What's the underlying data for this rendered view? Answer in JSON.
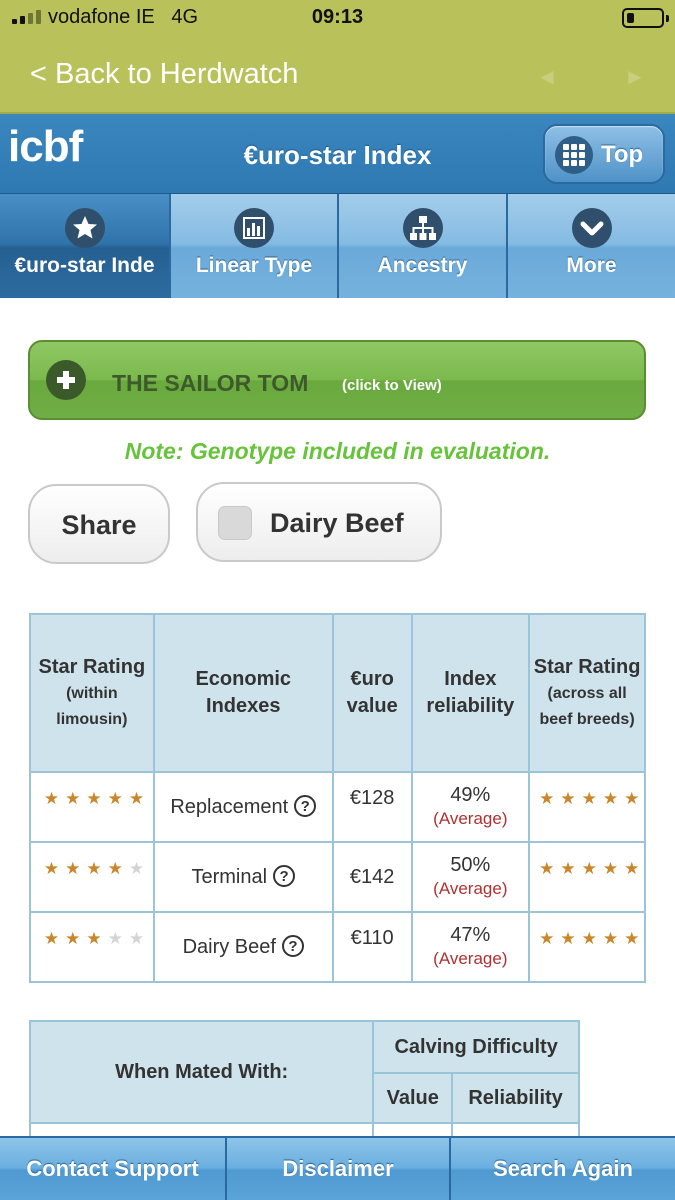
{
  "status_bar": {
    "carrier": "vodafone IE",
    "network": "4G",
    "time": "09:13"
  },
  "nav": {
    "back_label": "< Back to Herdwatch",
    "prev_arrow": "◄",
    "next_arrow": "►"
  },
  "header": {
    "logo": "icbf",
    "title": "€uro-star Index",
    "top_button_label": "Top",
    "top_button_icon": "grid-icon"
  },
  "tabs": [
    {
      "label": "€uro-star Inde",
      "icon": "star-icon",
      "active": true
    },
    {
      "label": "Linear Type",
      "icon": "bar-chart-icon",
      "active": false
    },
    {
      "label": "Ancestry",
      "icon": "hierarchy-icon",
      "active": false
    },
    {
      "label": "More",
      "icon": "chevron-down-icon",
      "active": false
    }
  ],
  "animal": {
    "name": "THE SAILOR TOM",
    "click_hint": "(click to View)",
    "note": "Note: Genotype included in evaluation."
  },
  "actions": {
    "share_label": "Share",
    "dairy_beef_label": "Dairy Beef",
    "dairy_beef_checked": false
  },
  "index_table": {
    "headers": {
      "star_within": "Star Rating",
      "star_within_sub": "(within limousin)",
      "economic": "Economic Indexes",
      "euro": "€uro value",
      "reliability": "Index reliability",
      "star_across": "Star Rating",
      "star_across_sub": "(across all beef breeds)"
    },
    "rows": [
      {
        "index": "Replacement",
        "stars_within": 5,
        "value": "€128",
        "reliability": "49%",
        "reliability_label": "(Average)",
        "stars_across": 5
      },
      {
        "index": "Terminal",
        "stars_within": 4,
        "value": "€142",
        "reliability": "50%",
        "reliability_label": "(Average)",
        "stars_across": 5
      },
      {
        "index": "Dairy Beef",
        "stars_within": 3,
        "value": "€110",
        "reliability": "47%",
        "reliability_label": "(Average)",
        "stars_across": 5
      }
    ],
    "help_glyph": "?",
    "star_glyph": "★"
  },
  "calving_table": {
    "mated_with_label": "When Mated With:",
    "group_label": "Calving Difficulty",
    "value_label": "Value",
    "reliability_label": "Reliability"
  },
  "footer": {
    "contact": "Contact Support",
    "disclaimer": "Disclaimer",
    "search": "Search Again"
  },
  "colors": {
    "olive_bar": "#b9c25a",
    "header_blue": "#2f79b2",
    "tab_light": "#84bbe2",
    "green_button": "#7bb94d",
    "note_green": "#66c33a",
    "star_gold": "#c9862a",
    "star_grey": "#d4d4d4",
    "table_header_bg": "#cfe3ec",
    "table_border": "#9cc4d8",
    "average_red": "#b03030"
  }
}
